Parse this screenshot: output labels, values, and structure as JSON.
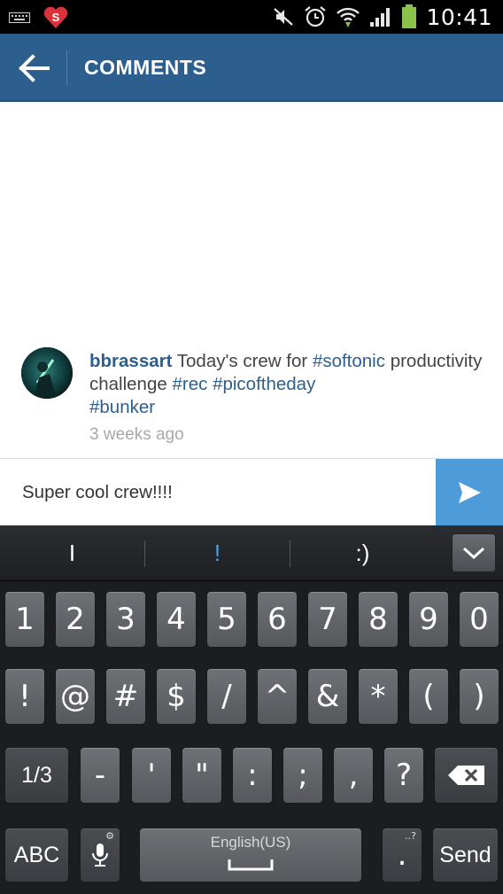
{
  "status_bar": {
    "time": "10:41",
    "icons": [
      "keyboard-icon",
      "app-notification-icon",
      "mute-icon",
      "alarm-icon",
      "wifi-icon",
      "signal-icon",
      "battery-icon"
    ]
  },
  "action_bar": {
    "title": "COMMENTS"
  },
  "comment": {
    "username": "bbrassart",
    "text_1": " Today's crew for ",
    "tag_1": "#softonic",
    "text_2": " productivity challenge ",
    "tag_2": "#rec",
    "space": " ",
    "tag_3": "#picoftheday",
    "tag_4": "#bunker",
    "time_ago": "3 weeks ago"
  },
  "input": {
    "value": "Super cool crew!!!!"
  },
  "keyboard": {
    "suggestions": [
      "I",
      "!",
      ":)"
    ],
    "row1": [
      "1",
      "2",
      "3",
      "4",
      "5",
      "6",
      "7",
      "8",
      "9",
      "0"
    ],
    "row2": [
      "!",
      "@",
      "#",
      "$",
      "/",
      "^",
      "&",
      "*",
      "(",
      ")"
    ],
    "row3": [
      "1/3",
      "-",
      "'",
      "\"",
      ":",
      ";",
      ",",
      "?"
    ],
    "abc": "ABC",
    "space_label": "English(US)",
    "period": ".",
    "send": "Send"
  },
  "colors": {
    "action_bar": "#2d5f8e",
    "link": "#2d5f8e",
    "send_button": "#4d9bd9",
    "suggestion_highlight": "#4aa3ea"
  }
}
